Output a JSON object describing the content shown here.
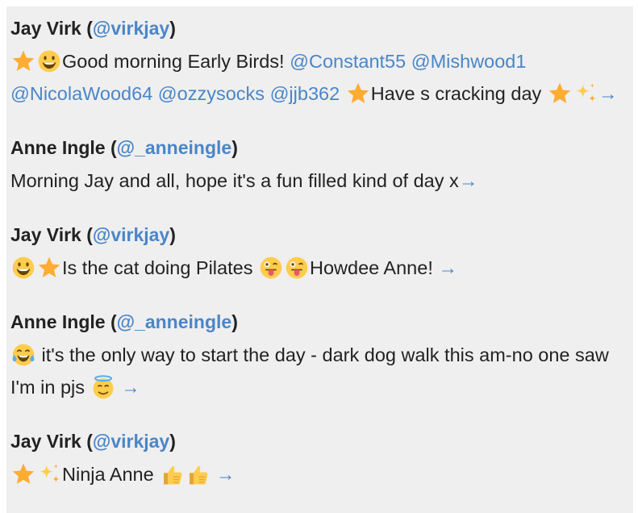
{
  "tweets": [
    {
      "author": "Jay Virk",
      "handle": "@virkjay",
      "segments": [
        {
          "type": "emoji",
          "name": "star-emoji"
        },
        {
          "type": "emoji",
          "name": "grinning-face-emoji"
        },
        {
          "type": "text",
          "value": "Good morning Early Birds! "
        },
        {
          "type": "mention",
          "value": "@Constant55"
        },
        {
          "type": "text",
          "value": " "
        },
        {
          "type": "mention",
          "value": "@Mishwood1"
        },
        {
          "type": "text",
          "value": " "
        },
        {
          "type": "mention",
          "value": "@NicolaWood64"
        },
        {
          "type": "text",
          "value": " "
        },
        {
          "type": "mention",
          "value": "@ozzysocks"
        },
        {
          "type": "text",
          "value": " "
        },
        {
          "type": "mention",
          "value": "@jjb362"
        },
        {
          "type": "text",
          "value": " "
        },
        {
          "type": "emoji",
          "name": "star-emoji"
        },
        {
          "type": "text",
          "value": "Have s cracking day "
        },
        {
          "type": "emoji",
          "name": "star-emoji"
        },
        {
          "type": "emoji",
          "name": "sparkles-emoji"
        },
        {
          "type": "arrow",
          "value": "→"
        }
      ]
    },
    {
      "author": "Anne Ingle",
      "handle": "@_anneingle",
      "segments": [
        {
          "type": "text",
          "value": "Morning Jay and all, hope it's a fun filled kind of day x"
        },
        {
          "type": "arrow",
          "value": "→"
        }
      ]
    },
    {
      "author": "Jay Virk",
      "handle": "@virkjay",
      "segments": [
        {
          "type": "emoji",
          "name": "grinning-face-emoji"
        },
        {
          "type": "emoji",
          "name": "star-emoji"
        },
        {
          "type": "text",
          "value": "Is the cat doing Pilates "
        },
        {
          "type": "emoji",
          "name": "winking-tongue-emoji"
        },
        {
          "type": "emoji",
          "name": "winking-tongue-emoji"
        },
        {
          "type": "text",
          "value": "Howdee Anne! "
        },
        {
          "type": "arrow",
          "value": "→"
        }
      ]
    },
    {
      "author": "Anne Ingle",
      "handle": "@_anneingle",
      "segments": [
        {
          "type": "emoji",
          "name": "tears-of-joy-emoji"
        },
        {
          "type": "text",
          "value": " it's the only way to start the day - dark dog walk this am-no one saw I'm in pjs "
        },
        {
          "type": "emoji",
          "name": "halo-face-emoji"
        },
        {
          "type": "text",
          "value": " "
        },
        {
          "type": "arrow",
          "value": "→"
        }
      ]
    },
    {
      "author": "Jay Virk",
      "handle": "@virkjay",
      "segments": [
        {
          "type": "emoji",
          "name": "star-emoji"
        },
        {
          "type": "emoji",
          "name": "sparkles-emoji"
        },
        {
          "type": "text",
          "value": "Ninja Anne "
        },
        {
          "type": "emoji",
          "name": "thumbs-up-emoji"
        },
        {
          "type": "emoji",
          "name": "thumbs-up-emoji"
        },
        {
          "type": "text",
          "value": " "
        },
        {
          "type": "arrow",
          "value": "→"
        }
      ]
    }
  ],
  "colors": {
    "mention": "#4a86c8",
    "text": "#222222",
    "background": "#efefef"
  }
}
